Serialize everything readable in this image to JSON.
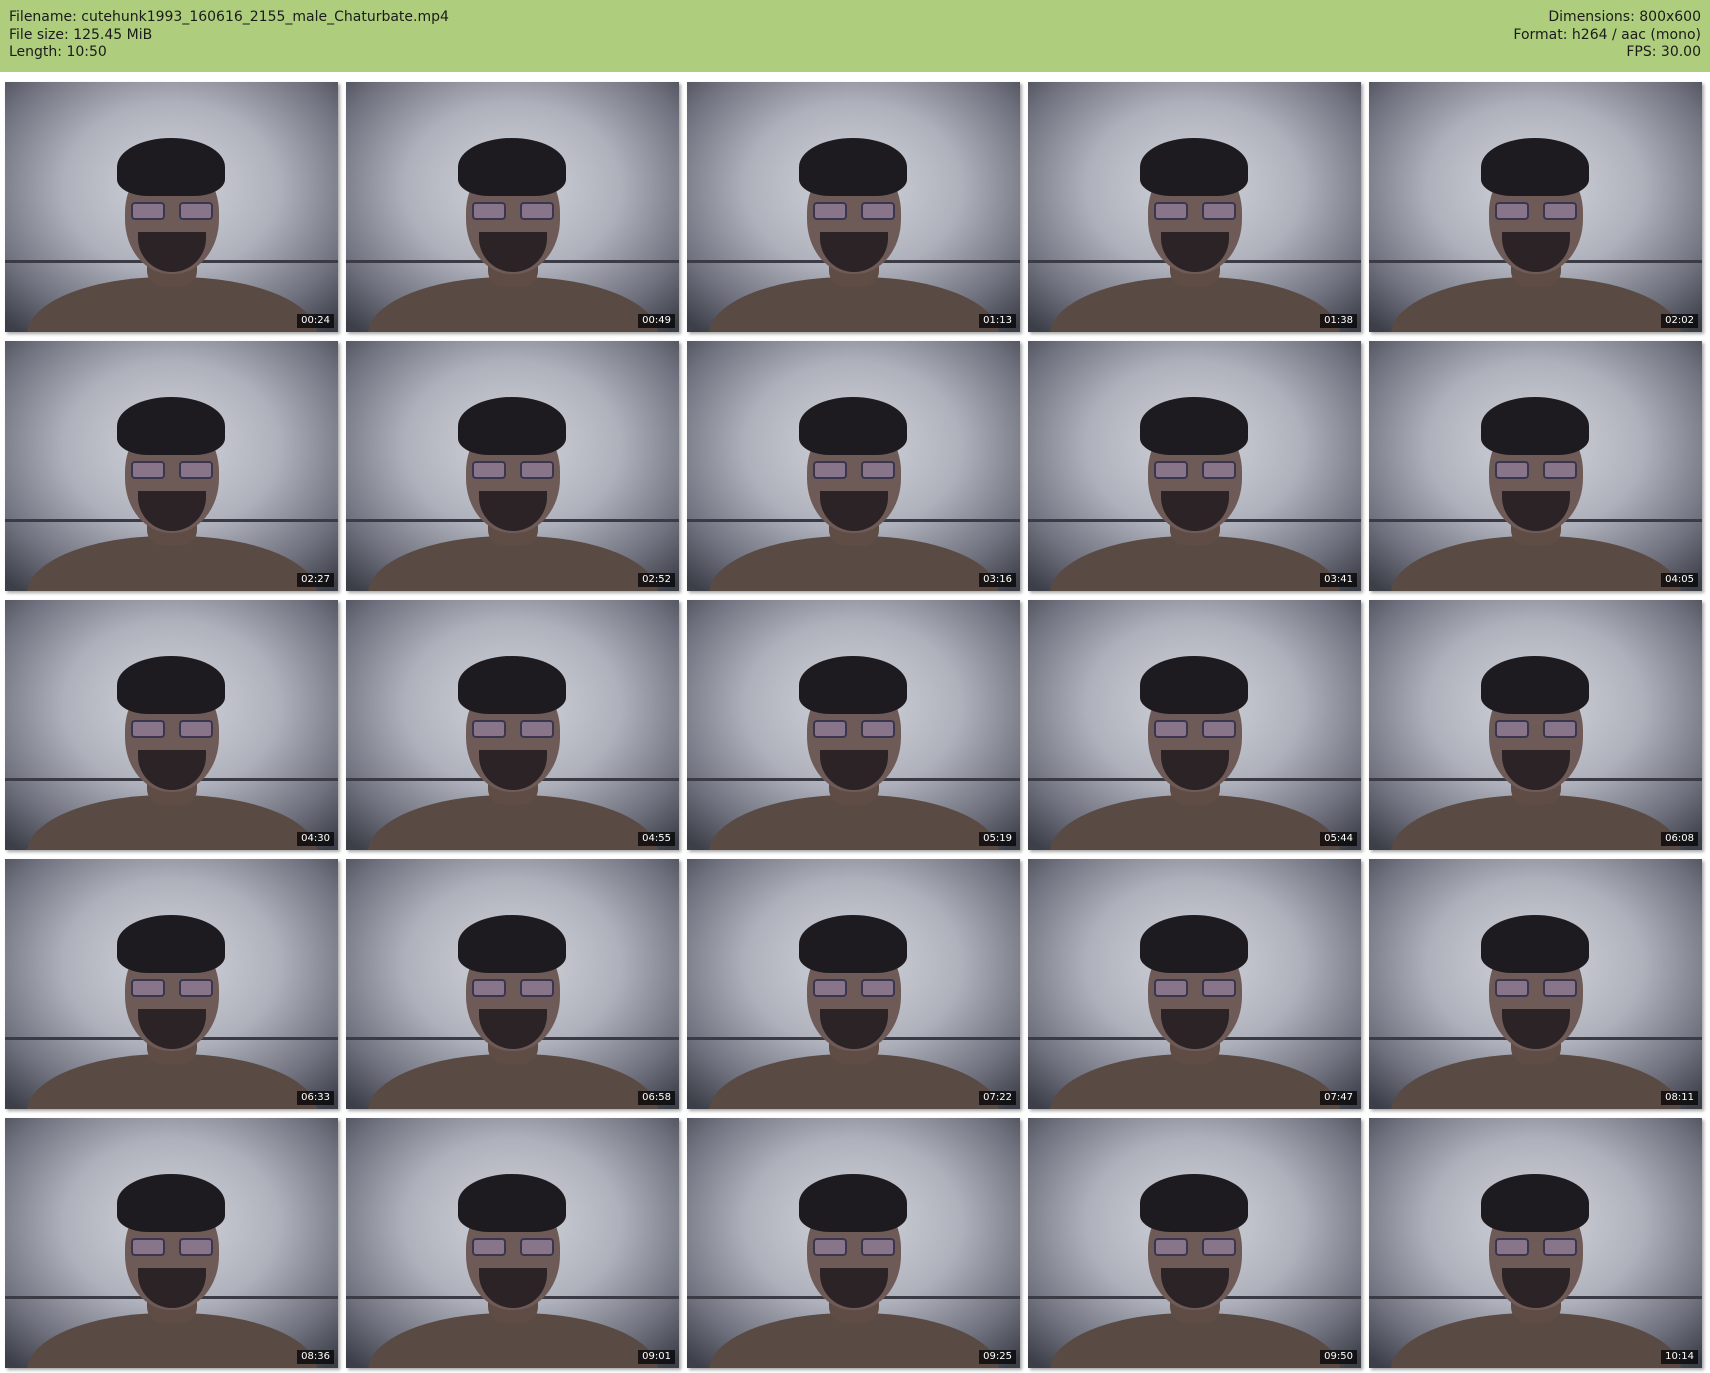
{
  "header": {
    "filename_line": "Filename: cutehunk1993_160616_2155_male_Chaturbate.mp4",
    "filesize_line": "File size: 125.45 MiB",
    "length_line": "Length: 10:50",
    "dimensions_line": "Dimensions: 800x600",
    "format_line": "Format: h264 / aac (mono)",
    "fps_line": "FPS: 30.00"
  },
  "colors": {
    "header_background": "#aece7d",
    "page_background": "#ffffff",
    "timestamp_background": "#000000",
    "timestamp_text": "#ffffff"
  },
  "frames": [
    {
      "timestamp": "00:24"
    },
    {
      "timestamp": "00:49"
    },
    {
      "timestamp": "01:13"
    },
    {
      "timestamp": "01:38"
    },
    {
      "timestamp": "02:02"
    },
    {
      "timestamp": "02:27"
    },
    {
      "timestamp": "02:52"
    },
    {
      "timestamp": "03:16"
    },
    {
      "timestamp": "03:41"
    },
    {
      "timestamp": "04:05"
    },
    {
      "timestamp": "04:30"
    },
    {
      "timestamp": "04:55"
    },
    {
      "timestamp": "05:19"
    },
    {
      "timestamp": "05:44"
    },
    {
      "timestamp": "06:08"
    },
    {
      "timestamp": "06:33"
    },
    {
      "timestamp": "06:58"
    },
    {
      "timestamp": "07:22"
    },
    {
      "timestamp": "07:47"
    },
    {
      "timestamp": "08:11"
    },
    {
      "timestamp": "08:36"
    },
    {
      "timestamp": "09:01"
    },
    {
      "timestamp": "09:25"
    },
    {
      "timestamp": "09:50"
    },
    {
      "timestamp": "10:14"
    }
  ]
}
